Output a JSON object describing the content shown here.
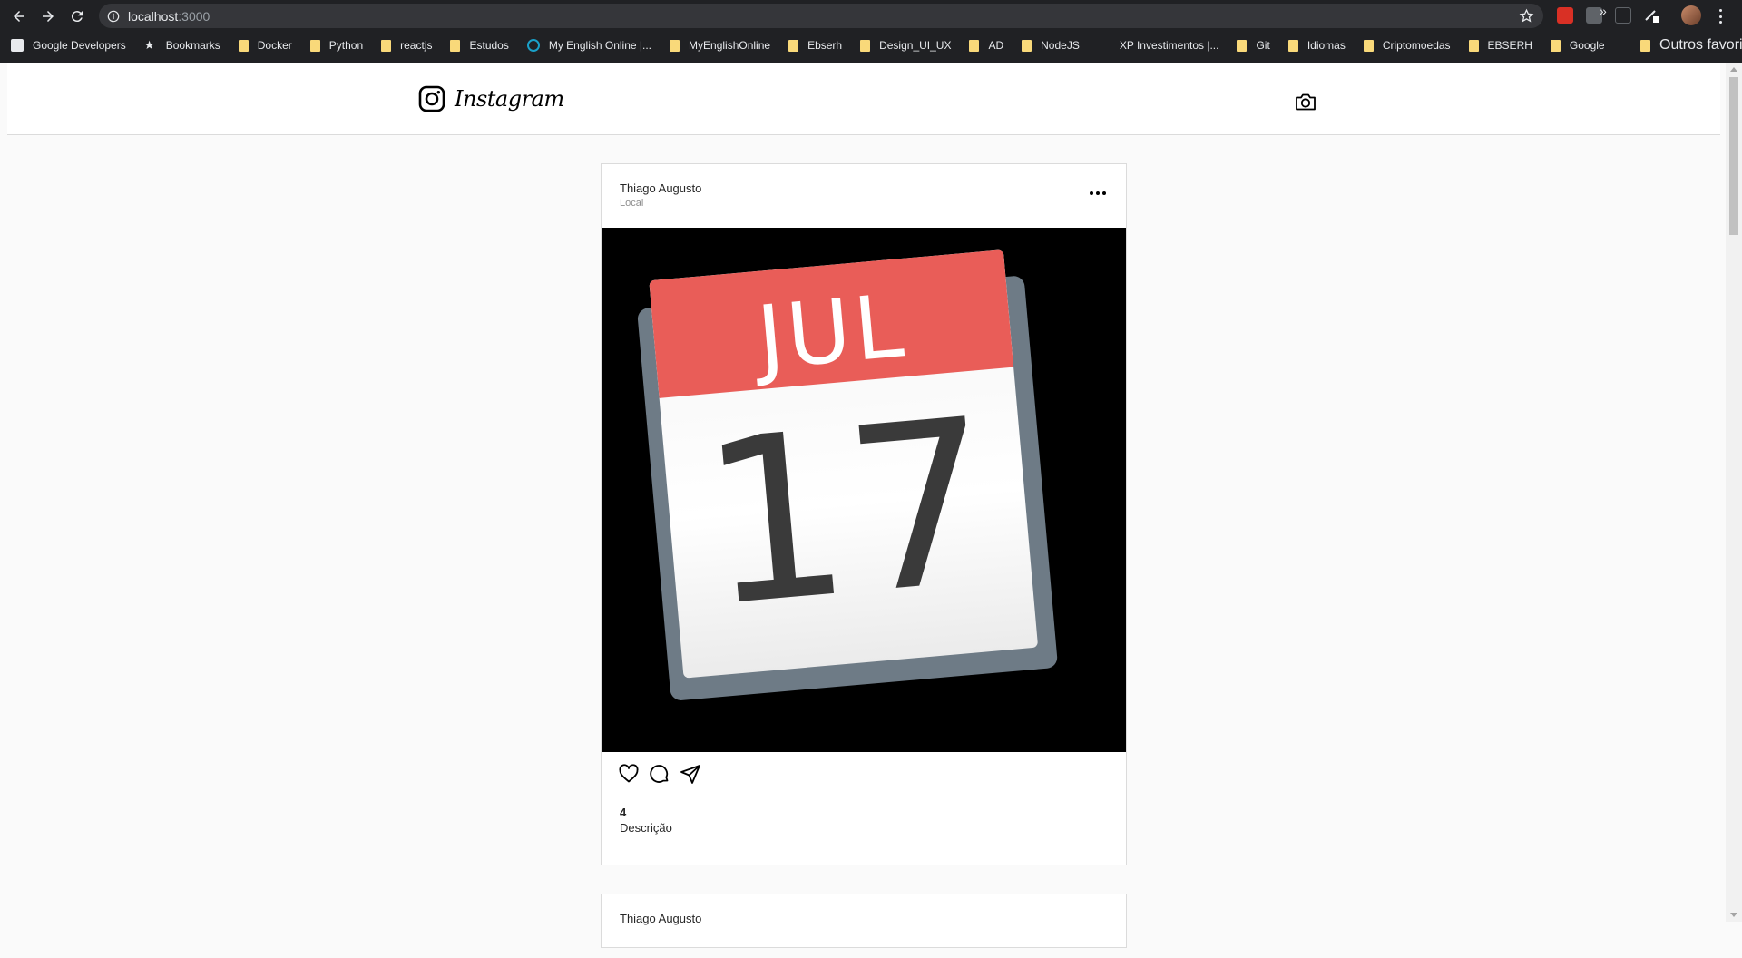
{
  "browser": {
    "url_host": "localhost",
    "url_port": ":3000",
    "bookmarks": [
      {
        "label": "Google Developers",
        "icon": "google-developers-icon"
      },
      {
        "label": "Bookmarks",
        "icon": "star-icon"
      },
      {
        "label": "Docker",
        "icon": "folder-icon"
      },
      {
        "label": "Python",
        "icon": "folder-icon"
      },
      {
        "label": "reactjs",
        "icon": "folder-icon"
      },
      {
        "label": "Estudos",
        "icon": "folder-icon"
      },
      {
        "label": "My English Online |...",
        "icon": "myenglish-icon"
      },
      {
        "label": "MyEnglishOnline",
        "icon": "folder-icon"
      },
      {
        "label": "Ebserh",
        "icon": "folder-icon"
      },
      {
        "label": "Design_UI_UX",
        "icon": "folder-icon"
      },
      {
        "label": "AD",
        "icon": "folder-icon"
      },
      {
        "label": "NodeJS",
        "icon": "folder-icon"
      },
      {
        "label": "XP Investimentos |...",
        "icon": "xp-icon"
      },
      {
        "label": "Git",
        "icon": "folder-icon"
      },
      {
        "label": "Idiomas",
        "icon": "folder-icon"
      },
      {
        "label": "Criptomoedas",
        "icon": "folder-icon"
      },
      {
        "label": "EBSERH",
        "icon": "folder-icon"
      },
      {
        "label": "Google",
        "icon": "folder-icon"
      }
    ],
    "more_label": "»",
    "other_bookmarks": "Outros favoritos"
  },
  "header": {
    "logo_text": "Instagram"
  },
  "posts": [
    {
      "author": "Thiago Augusto",
      "place": "Local",
      "image": {
        "month": "JUL",
        "day": "17"
      },
      "likes": "4",
      "description": "Descrição"
    },
    {
      "author": "Thiago Augusto"
    }
  ],
  "colors": {
    "chrome_bg": "#202124",
    "page_bg": "#fafafa",
    "border": "#dbdbdb",
    "calendar_red": "#e95d58",
    "folder_yellow": "#f9d97a"
  }
}
